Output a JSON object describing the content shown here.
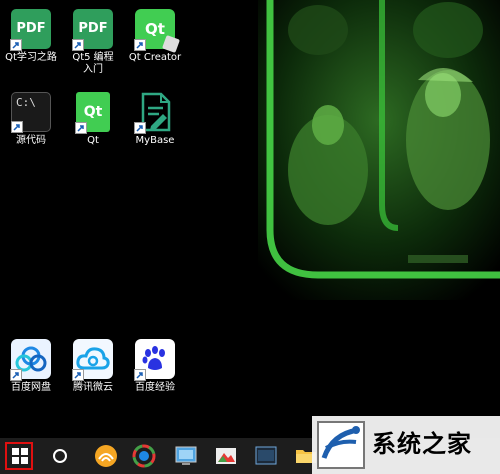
{
  "desktop": {
    "icons": [
      {
        "label": "Qt学习之路",
        "tile_text": "PDF",
        "kind": "pdf"
      },
      {
        "label": "Qt5 编程入门",
        "tile_text": "PDF",
        "kind": "pdf"
      },
      {
        "label": "Qt Creator",
        "tile_text": "Qt",
        "kind": "qtcreator"
      },
      {
        "label": "源代码",
        "tile_text": "C:\\",
        "kind": "cmd"
      },
      {
        "label": "Qt",
        "tile_text": "Qt",
        "kind": "qt"
      },
      {
        "label": "MyBase",
        "tile_text": "",
        "kind": "mybase"
      },
      {
        "label": "百度网盘",
        "tile_text": "",
        "kind": "baidu-netdisk"
      },
      {
        "label": "腾讯微云",
        "tile_text": "",
        "kind": "weiyun"
      },
      {
        "label": "百度经验",
        "tile_text": "",
        "kind": "baidu-jingyan"
      }
    ]
  },
  "taskbar": {
    "items": [
      "windows-start-icon",
      "cortana-search-icon",
      "browser-icon",
      "colorful-app-icon",
      "control-panel-icon",
      "photo-app-icon",
      "terminal-app-icon",
      "file-explorer-icon"
    ]
  },
  "watermark": {
    "text": "系统之家"
  },
  "colors": {
    "accent_green": "#2f9e5c",
    "taskbar": "#1d1d1d",
    "highlight": "#e01010"
  }
}
